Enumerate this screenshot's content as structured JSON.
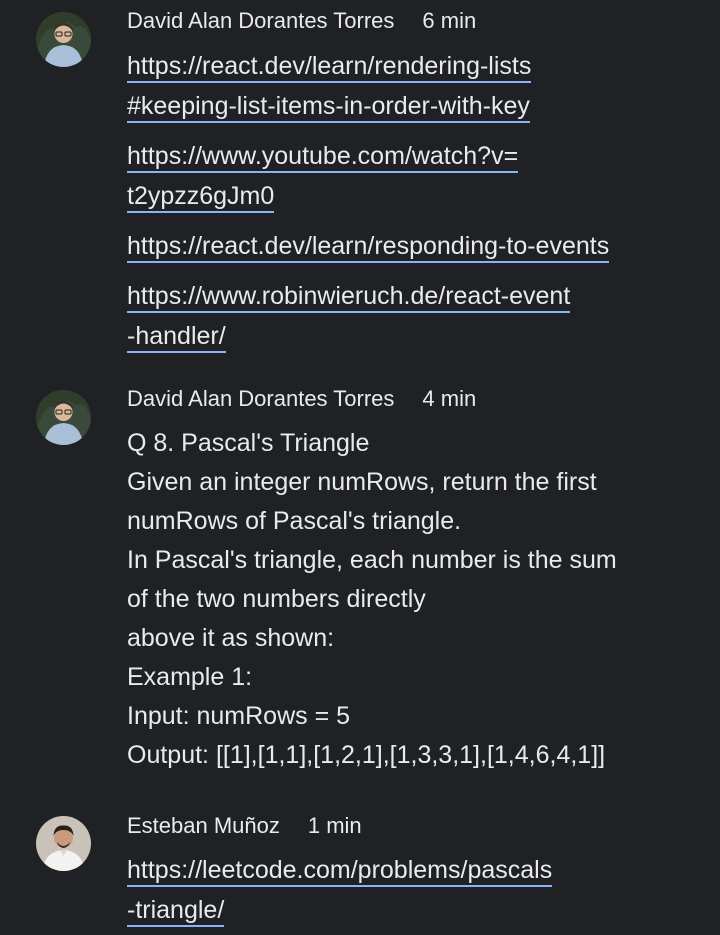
{
  "messages": [
    {
      "author": "David Alan Dorantes Torres",
      "time": "6 min",
      "avatar_icon": "user-avatar-glasses-icon",
      "links": [
        [
          "https://react.dev/learn/rendering-lists",
          "#keeping-list-items-in-order-with-key"
        ],
        [
          "https://www.youtube.com/watch?v=",
          "t2ypzz6gJm0"
        ],
        [
          "https://react.dev/learn/responding-to-events"
        ],
        [
          "https://www.robinwieruch.de/react-event",
          "-handler/"
        ]
      ]
    },
    {
      "author": "David Alan Dorantes Torres",
      "time": "4 min",
      "avatar_icon": "user-avatar-glasses-icon",
      "lines": [
        "Q 8. Pascal's Triangle",
        "Given an integer numRows, return the first",
        "numRows of Pascal's triangle.",
        "In Pascal's triangle, each number is the sum",
        "of the two numbers directly",
        "above it as shown:",
        "Example 1:",
        "Input: numRows = 5",
        "Output: [[1],[1,1],[1,2,1],[1,3,3,1],[1,4,6,4,1]]"
      ]
    },
    {
      "author": "Esteban Muñoz",
      "time": "1 min",
      "avatar_icon": "user-avatar-icon",
      "links": [
        [
          "https://leetcode.com/problems/pascals",
          "-triangle/"
        ]
      ]
    }
  ],
  "colors": {
    "background": "#202124",
    "text": "#e8eaed",
    "link_underline": "#8ab4f8"
  }
}
